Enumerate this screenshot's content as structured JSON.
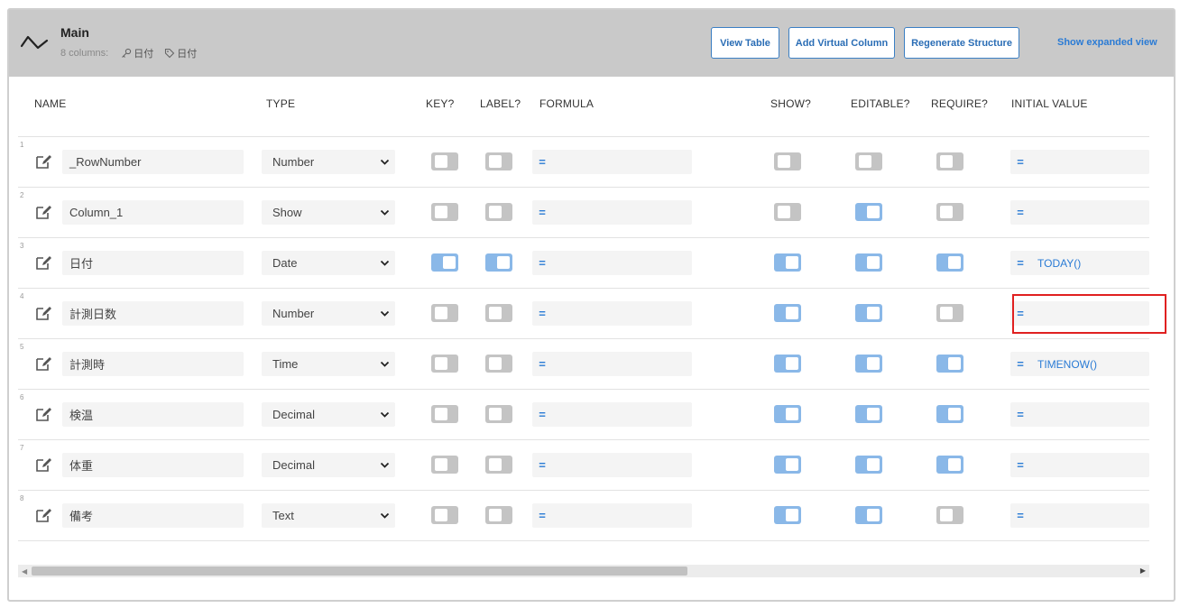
{
  "table": {
    "title": "Main",
    "column_count": "8 columns:",
    "key_chip": "日付",
    "label_chip": "日付"
  },
  "toolbar": {
    "view_table": "View Table",
    "add_virtual_column": "Add Virtual Column",
    "regenerate_structure": "Regenerate Structure",
    "show_expanded_view": "Show expanded view"
  },
  "columns_header": {
    "name": "NAME",
    "type": "TYPE",
    "key": "KEY?",
    "label": "LABEL?",
    "formula": "FORMULA",
    "show": "SHOW?",
    "editable": "EDITABLE?",
    "require": "REQUIRE?",
    "initial_value": "INITIAL VALUE"
  },
  "rows": [
    {
      "num": "1",
      "name": "_RowNumber",
      "type": "Number",
      "key": false,
      "label": false,
      "formula": "",
      "show": false,
      "editable": false,
      "require": false,
      "initial": ""
    },
    {
      "num": "2",
      "name": "Column_1",
      "type": "Show",
      "key": false,
      "label": false,
      "formula": "",
      "show": false,
      "editable": true,
      "require": false,
      "initial": ""
    },
    {
      "num": "3",
      "name": "日付",
      "type": "Date",
      "key": true,
      "label": true,
      "formula": "",
      "show": true,
      "editable": true,
      "require": true,
      "initial": "TODAY()"
    },
    {
      "num": "4",
      "name": "計測日数",
      "type": "Number",
      "key": false,
      "label": false,
      "formula": "",
      "show": true,
      "editable": true,
      "require": false,
      "initial": ""
    },
    {
      "num": "5",
      "name": "計測時",
      "type": "Time",
      "key": false,
      "label": false,
      "formula": "",
      "show": true,
      "editable": true,
      "require": true,
      "initial": "TIMENOW()"
    },
    {
      "num": "6",
      "name": "検温",
      "type": "Decimal",
      "key": false,
      "label": false,
      "formula": "",
      "show": true,
      "editable": true,
      "require": true,
      "initial": ""
    },
    {
      "num": "7",
      "name": "体重",
      "type": "Decimal",
      "key": false,
      "label": false,
      "formula": "",
      "show": true,
      "editable": true,
      "require": true,
      "initial": ""
    },
    {
      "num": "8",
      "name": "備考",
      "type": "Text",
      "key": false,
      "label": false,
      "formula": "",
      "show": true,
      "editable": true,
      "require": false,
      "initial": ""
    }
  ],
  "eq_symbol": "=",
  "colors": {
    "accent": "#2a7bd5",
    "toggle_on": "#8ab8e8",
    "toggle_off": "#c4c4c4",
    "header_bg": "#c9c9c9",
    "highlight": "#e02020"
  }
}
